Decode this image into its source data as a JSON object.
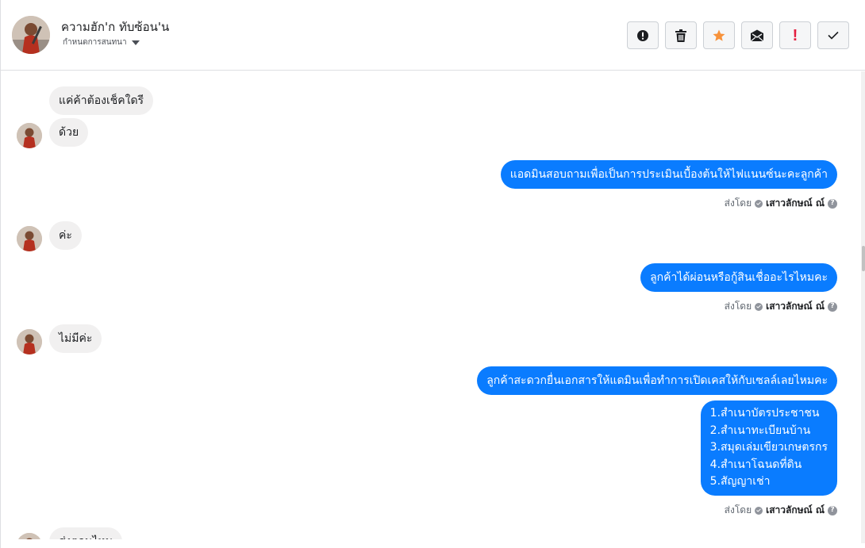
{
  "header": {
    "contact_name": "ความฮัก'ก ทับซ้อน'น",
    "subtitle": "กำหนดการสนทนา"
  },
  "toolbar": {
    "buttons": [
      "report-icon",
      "trash-icon",
      "star-icon",
      "mark-unread-icon",
      "important-icon",
      "done-icon"
    ]
  },
  "colors": {
    "accent": "#0a7cff",
    "incoming_bubble": "#f1f0f0",
    "star": "#f7923b",
    "important": "#e41e3f"
  },
  "messages": [
    {
      "side": "in",
      "text": "แค่ค้าต้องเช็คใดรี"
    },
    {
      "side": "in",
      "text": "ด้วย"
    },
    {
      "side": "out",
      "text": "แอดมินสอบถามเพื่อเป็นการประเมินเบื้องต้นให้ไฟแนนซ์นะคะลูกค้า"
    },
    {
      "side": "in",
      "text": "ค่ะ"
    },
    {
      "side": "out",
      "text": "ลูกค้าได้ผ่อนหรือกู้สินเชื่ออะไรไหมคะ"
    },
    {
      "side": "in",
      "text": "ไม่มีค่ะ"
    },
    {
      "side": "out",
      "text": "ลูกค้าสะดวกยื่นเอกสารให้แดมินเพื่อทำการเปิดเคสให้กับเซลล์เลยไหมคะ"
    },
    {
      "side": "out",
      "lines": [
        "1.สำเนาบัตรประชาชน",
        "2.สำเนาทะเบียนบ้าน",
        "3.สมุดเล่มเขียวเกษตรกร",
        "4.สำเนาโฉนดที่ดิน",
        "5.สัญญาเช่า"
      ]
    },
    {
      "side": "in",
      "text": "ส่งตอนไหน"
    }
  ],
  "sent_by": {
    "prefix": "ส่งโดย",
    "name": "เสาวลักษณ์ ณ์"
  }
}
